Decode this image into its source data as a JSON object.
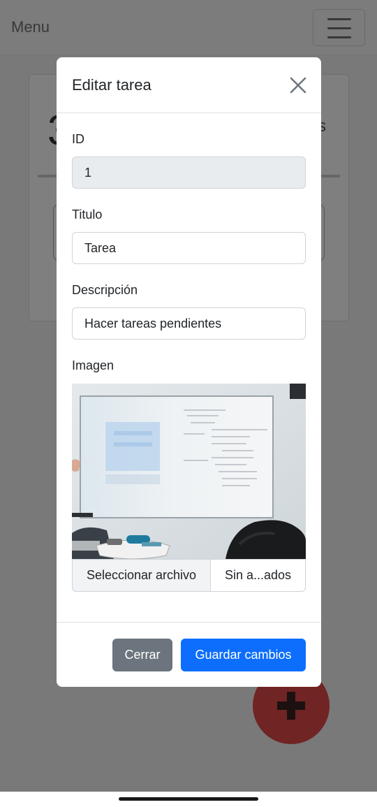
{
  "app": {
    "brand": "Menu",
    "card_number": "3",
    "card_suffix": "s"
  },
  "modal": {
    "title": "Editar tarea",
    "id_label": "ID",
    "id_value": "1",
    "title_label": "Titulo",
    "title_value": "Tarea",
    "description_label": "Descripción",
    "description_value": "Hacer tareas pendientes",
    "image_label": "Imagen",
    "image_icon": "whiteboard-photo",
    "file_button": "Seleccionar archivo",
    "file_status": "Sin a...ados",
    "close_button": "Cerrar",
    "save_button": "Guardar cambios"
  },
  "colors": {
    "primary": "#0d6efd",
    "secondary": "#6c757d",
    "fab": "#e04848"
  }
}
